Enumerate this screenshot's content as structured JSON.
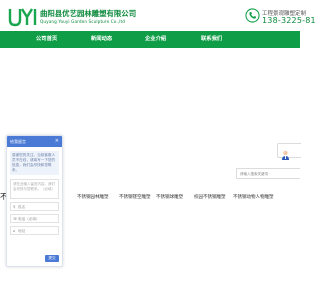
{
  "header": {
    "logo_text": "UYI",
    "company_name": "曲阳县优艺园林雕塑有限公司",
    "company_name_en": "Quyang Youyi Garden Sculpture Co.,ltd",
    "phone_label": "工程景观雕塑定制",
    "phone_number": "138-3225-81",
    "phone_icon": "phone-icon"
  },
  "nav": {
    "items": [
      {
        "label": "公司首页"
      },
      {
        "label": "新闻动态"
      },
      {
        "label": "企业介绍"
      },
      {
        "label": "联系我们"
      }
    ]
  },
  "search": {
    "placeholder": "请输入搜索关键词"
  },
  "categories": {
    "partial": "不",
    "tabs": [
      {
        "label": "锈钢雕塑"
      },
      {
        "label": "不锈钢园林雕塑"
      },
      {
        "label": "不锈钢镂空雕塑"
      },
      {
        "label": "不锈钢球雕塑"
      },
      {
        "label": "校园不锈钢雕塑"
      },
      {
        "label": "不锈钢动物人物雕塑"
      }
    ]
  },
  "chat": {
    "title": "给我留言",
    "close": "×",
    "message": "感谢您的关注，当前客服人员不在线，请填写一下您的信息，我们会尽快和您联系。",
    "textarea_placeholder": "请在此输入留言内容，我们会尽快与您联系。（必填）",
    "name_placeholder": "姓名",
    "phone_placeholder": "电话（必填）",
    "address_placeholder": "地址",
    "submit": "提交"
  },
  "colors": {
    "brand_green": "#0f9e47",
    "chat_blue": "#4a7ad6"
  }
}
